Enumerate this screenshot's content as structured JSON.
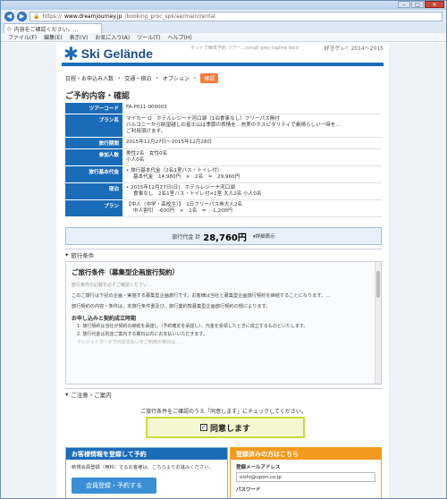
{
  "browser": {
    "url_scheme": "https://",
    "url_host": "www.dreamjourney.jp",
    "url_path": "/booking_proc_spk/ae/main/rental",
    "tab_title": "内容をご確認ください。...",
    "menu": [
      "ファイル(F)",
      "編集(E)",
      "表示(V)",
      "お気に入り(A)",
      "ツール(T)",
      "ヘルプ(H)"
    ],
    "buttons": {
      "minimize": "–",
      "maximize": "□",
      "close": "✕"
    }
  },
  "header": {
    "logo_text": "Ski Gelände",
    "tagline": "ネットで簡単予約 ツアー…(small grey tagline text)",
    "site_link": "好きゲレ！2014〜2015"
  },
  "breadcrumb": [
    "日程・お申込み人数",
    "交通・宿泊",
    "オプション",
    "確認"
  ],
  "page_title": "ご予約内容・確認",
  "details": [
    {
      "label": "ツアーコード",
      "lines": [
        "FA-P011-000003"
      ]
    },
    {
      "label": "プラン名",
      "lines": [
        "マイカー Q　ホテルレジーナ河口湖（1泊食事なし）フリーパス無付",
        "パルコニーから眺望越しの富士山は季節の表情を…充実のホスピタリティで素晴らしい一時を…",
        "ご利用頂けます。"
      ]
    },
    {
      "label": "旅行期間",
      "lines": [
        "2015年12月27日〜2015年12月28日"
      ]
    },
    {
      "label": "参加人数",
      "lines": [
        "男性2名　女性0名",
        "小人0名"
      ]
    },
    {
      "label": "旅行基本代金",
      "lines": [
        "• 旅行基本代金（2名1室バス・トイレ付）",
        "基本代金　14,980円　×　2名　=　29,960円"
      ]
    },
    {
      "label": "宿泊",
      "lines": [
        "• 2015年12月27日(日)　ホテルレジーナ河口湖",
        "食事なし　2名1室バス・トイレ付×1室 大人2名 小人0名"
      ]
    },
    {
      "label": "プラン",
      "lines": [
        "【中人（中学・高校生）】　1日フリーパス券大人2名",
        "中人割引　-600円　×　2名　=　-1,200円"
      ]
    }
  ],
  "total": {
    "label": "旅行代金 計",
    "amount": "28,760円",
    "detail_link": "詳細表示"
  },
  "terms": {
    "section_label": "旅行条件",
    "title": "ご旅行条件（募集型企画旅行契約）",
    "faint_line": "旅行条件の記載を必ずご確認ください…",
    "body": "このご旅行は下記の企画・実施する募集型企画旅行です。お客様は当社と募集型企画旅行契約を締結することになります。…",
    "body2": "旅行契約の内容・条件は、本旅行条件書及び、旅行業約款募集型企画旅行契約の部によります。",
    "subheading": "お申し込みと契約成立時期",
    "items": [
      "1. 旅行契約は当社が契約の締結を承諾し（予約確定を承認し）、代金を受領したときに成立するものといたします。",
      "2. 旅行代金は別途ご案内する期日以内にお支払いいただきます。"
    ],
    "muted": "クレジットカードでのお支払いをご利用の場合は、…"
  },
  "notice_label": "ご注意・ご案内",
  "agree": {
    "instruction": "ご旅行条件をご確認のうえ「同意します」にチェックしてください。",
    "label": "同意します",
    "checked": true
  },
  "register_panel": {
    "title": "お客様情報を登録して予約",
    "desc": "新規会員登録（無料）するお客様は、こちらよりお進みください。",
    "button": "会員登録・予約する"
  },
  "member_panel": {
    "title": "登録済みの方はこちら",
    "email_label": "登録メールアドレス",
    "email_value": "oishi@upon.co.jp",
    "password_label": "パスワード",
    "password_value": "••••••"
  },
  "colors": {
    "brand_blue": "#1b6cb8",
    "accent_orange": "#f47b3a",
    "agree_green": "#c9dc36"
  }
}
